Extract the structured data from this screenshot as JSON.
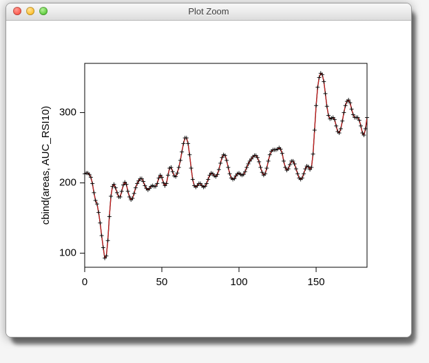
{
  "window": {
    "title": "Plot Zoom"
  },
  "chart_data": {
    "type": "line",
    "ylabel": "cbind(areas, AUC_RSI10)",
    "xlabel": "",
    "xlim": [
      0,
      183
    ],
    "ylim": [
      80,
      370
    ],
    "x_ticks": [
      0,
      50,
      100,
      150
    ],
    "y_ticks": [
      100,
      200,
      300
    ],
    "point_symbol": "+",
    "series": [
      {
        "name": "areas",
        "color": "#000000",
        "x": [
          0,
          1,
          2,
          3,
          4,
          5,
          6,
          7,
          8,
          9,
          10,
          11,
          12,
          13,
          14,
          15,
          16,
          17,
          18,
          19,
          20,
          21,
          22,
          23,
          24,
          25,
          26,
          27,
          28,
          29,
          30,
          31,
          32,
          33,
          34,
          35,
          36,
          37,
          38,
          39,
          40,
          41,
          42,
          43,
          44,
          45,
          46,
          47,
          48,
          49,
          50,
          51,
          52,
          53,
          54,
          55,
          56,
          57,
          58,
          59,
          60,
          61,
          62,
          63,
          64,
          65,
          66,
          67,
          68,
          69,
          70,
          71,
          72,
          73,
          74,
          75,
          76,
          77,
          78,
          79,
          80,
          81,
          82,
          83,
          84,
          85,
          86,
          87,
          88,
          89,
          90,
          91,
          92,
          93,
          94,
          95,
          96,
          97,
          98,
          99,
          100,
          101,
          102,
          103,
          104,
          105,
          106,
          107,
          108,
          109,
          110,
          111,
          112,
          113,
          114,
          115,
          116,
          117,
          118,
          119,
          120,
          121,
          122,
          123,
          124,
          125,
          126,
          127,
          128,
          129,
          130,
          131,
          132,
          133,
          134,
          135,
          136,
          137,
          138,
          139,
          140,
          141,
          142,
          143,
          144,
          145,
          146,
          147,
          148,
          149,
          150,
          151,
          152,
          153,
          154,
          155,
          156,
          157,
          158,
          159,
          160,
          161,
          162,
          163,
          164,
          165,
          166,
          167,
          168,
          169,
          170,
          171,
          172,
          173,
          174,
          175,
          176,
          177,
          178,
          179,
          180,
          181,
          182,
          183
        ],
        "values": [
          213,
          214,
          214,
          212,
          208,
          199,
          186,
          175,
          170,
          158,
          143,
          125,
          108,
          93,
          96,
          118,
          152,
          181,
          195,
          198,
          193,
          186,
          180,
          180,
          188,
          197,
          201,
          198,
          188,
          180,
          176,
          178,
          185,
          193,
          199,
          203,
          206,
          206,
          202,
          196,
          192,
          190,
          192,
          195,
          196,
          195,
          195,
          199,
          207,
          211,
          208,
          200,
          196,
          199,
          211,
          221,
          222,
          216,
          210,
          209,
          214,
          222,
          232,
          244,
          256,
          264,
          264,
          256,
          240,
          221,
          205,
          196,
          194,
          196,
          199,
          199,
          196,
          194,
          195,
          199,
          205,
          211,
          214,
          213,
          210,
          209,
          212,
          219,
          228,
          236,
          240,
          239,
          232,
          222,
          213,
          207,
          205,
          206,
          210,
          213,
          214,
          212,
          211,
          212,
          216,
          222,
          227,
          231,
          234,
          237,
          239,
          239,
          236,
          230,
          222,
          215,
          211,
          213,
          221,
          231,
          240,
          245,
          247,
          247,
          247,
          248,
          250,
          248,
          242,
          231,
          222,
          218,
          220,
          226,
          231,
          231,
          227,
          220,
          213,
          207,
          205,
          207,
          213,
          220,
          224,
          223,
          219,
          222,
          241,
          275,
          310,
          336,
          350,
          356,
          354,
          344,
          327,
          309,
          296,
          291,
          292,
          293,
          290,
          281,
          273,
          271,
          277,
          288,
          300,
          310,
          316,
          318,
          314,
          305,
          297,
          293,
          293,
          293,
          289,
          281,
          271,
          268,
          277,
          293
        ]
      },
      {
        "name": "AUC_RSI10",
        "color": "#d02020",
        "x": [
          0,
          1,
          2,
          3,
          4,
          5,
          6,
          7,
          8,
          9,
          10,
          11,
          12,
          13,
          14,
          15,
          16,
          17,
          18,
          19,
          20,
          21,
          22,
          23,
          24,
          25,
          26,
          27,
          28,
          29,
          30,
          31,
          32,
          33,
          34,
          35,
          36,
          37,
          38,
          39,
          40,
          41,
          42,
          43,
          44,
          45,
          46,
          47,
          48,
          49,
          50,
          51,
          52,
          53,
          54,
          55,
          56,
          57,
          58,
          59,
          60,
          61,
          62,
          63,
          64,
          65,
          66,
          67,
          68,
          69,
          70,
          71,
          72,
          73,
          74,
          75,
          76,
          77,
          78,
          79,
          80,
          81,
          82,
          83,
          84,
          85,
          86,
          87,
          88,
          89,
          90,
          91,
          92,
          93,
          94,
          95,
          96,
          97,
          98,
          99,
          100,
          101,
          102,
          103,
          104,
          105,
          106,
          107,
          108,
          109,
          110,
          111,
          112,
          113,
          114,
          115,
          116,
          117,
          118,
          119,
          120,
          121,
          122,
          123,
          124,
          125,
          126,
          127,
          128,
          129,
          130,
          131,
          132,
          133,
          134,
          135,
          136,
          137,
          138,
          139,
          140,
          141,
          142,
          143,
          144,
          145,
          146,
          147,
          148,
          149,
          150,
          151,
          152,
          153,
          154,
          155,
          156,
          157,
          158,
          159,
          160,
          161,
          162,
          163,
          164,
          165,
          166,
          167,
          168,
          169,
          170,
          171,
          172,
          173,
          174,
          175,
          176,
          177,
          178,
          179,
          180,
          181,
          182,
          183
        ],
        "values": [
          213,
          214,
          214,
          212,
          208,
          199,
          186,
          175,
          170,
          158,
          143,
          125,
          108,
          93,
          96,
          118,
          152,
          181,
          195,
          198,
          193,
          186,
          180,
          180,
          188,
          197,
          201,
          198,
          188,
          180,
          176,
          178,
          185,
          193,
          199,
          203,
          206,
          206,
          202,
          196,
          192,
          190,
          192,
          195,
          196,
          195,
          195,
          199,
          207,
          211,
          208,
          200,
          196,
          199,
          211,
          221,
          222,
          216,
          210,
          209,
          214,
          222,
          232,
          244,
          256,
          264,
          264,
          256,
          240,
          221,
          205,
          196,
          194,
          196,
          199,
          199,
          196,
          194,
          195,
          199,
          205,
          211,
          214,
          213,
          210,
          209,
          212,
          219,
          228,
          236,
          240,
          239,
          232,
          222,
          213,
          207,
          205,
          206,
          210,
          213,
          214,
          212,
          211,
          212,
          216,
          222,
          227,
          231,
          234,
          237,
          239,
          239,
          236,
          230,
          222,
          215,
          211,
          213,
          221,
          231,
          240,
          245,
          247,
          247,
          247,
          248,
          250,
          248,
          242,
          231,
          222,
          218,
          220,
          226,
          231,
          231,
          227,
          220,
          213,
          207,
          205,
          207,
          213,
          220,
          224,
          223,
          219,
          222,
          241,
          275,
          310,
          336,
          350,
          356,
          354,
          344,
          327,
          309,
          296,
          291,
          292,
          293,
          290,
          281,
          273,
          271,
          277,
          288,
          300,
          310,
          316,
          318,
          314,
          305,
          297,
          293,
          293,
          293,
          289,
          281,
          271,
          268,
          277,
          293
        ]
      }
    ]
  }
}
